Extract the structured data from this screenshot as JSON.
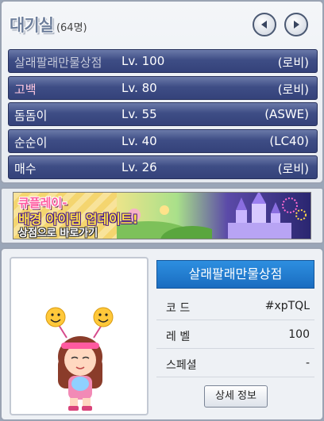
{
  "room": {
    "title": "대기실",
    "count": "(64명)"
  },
  "players": [
    {
      "name": "살래팔래만물상점",
      "level": "Lv. 100",
      "guild": "(로비)"
    },
    {
      "name": "고백",
      "level": "Lv. 80",
      "guild": "(로비)"
    },
    {
      "name": "돔돔이",
      "level": "Lv. 55",
      "guild": "(ASWE)"
    },
    {
      "name": "순순이",
      "level": "Lv. 40",
      "guild": "(LC40)"
    },
    {
      "name": "매수",
      "level": "Lv. 26",
      "guild": "(로비)"
    }
  ],
  "banner": {
    "line1": "큐플레이-",
    "line2": "배경 아이템 업데이트!",
    "line3": "상점으로 바로가기"
  },
  "detail": {
    "name": "살래팔래만물상점",
    "code_label": "코 드",
    "code_value": "#xpTQL",
    "level_label": "레 벨",
    "level_value": "100",
    "special_label": "스페셜",
    "special_value": "-",
    "detail_button": "상세 정보"
  },
  "colors": {
    "row_bg": "#3e4d85",
    "name_bar": "#1a6cc0"
  }
}
